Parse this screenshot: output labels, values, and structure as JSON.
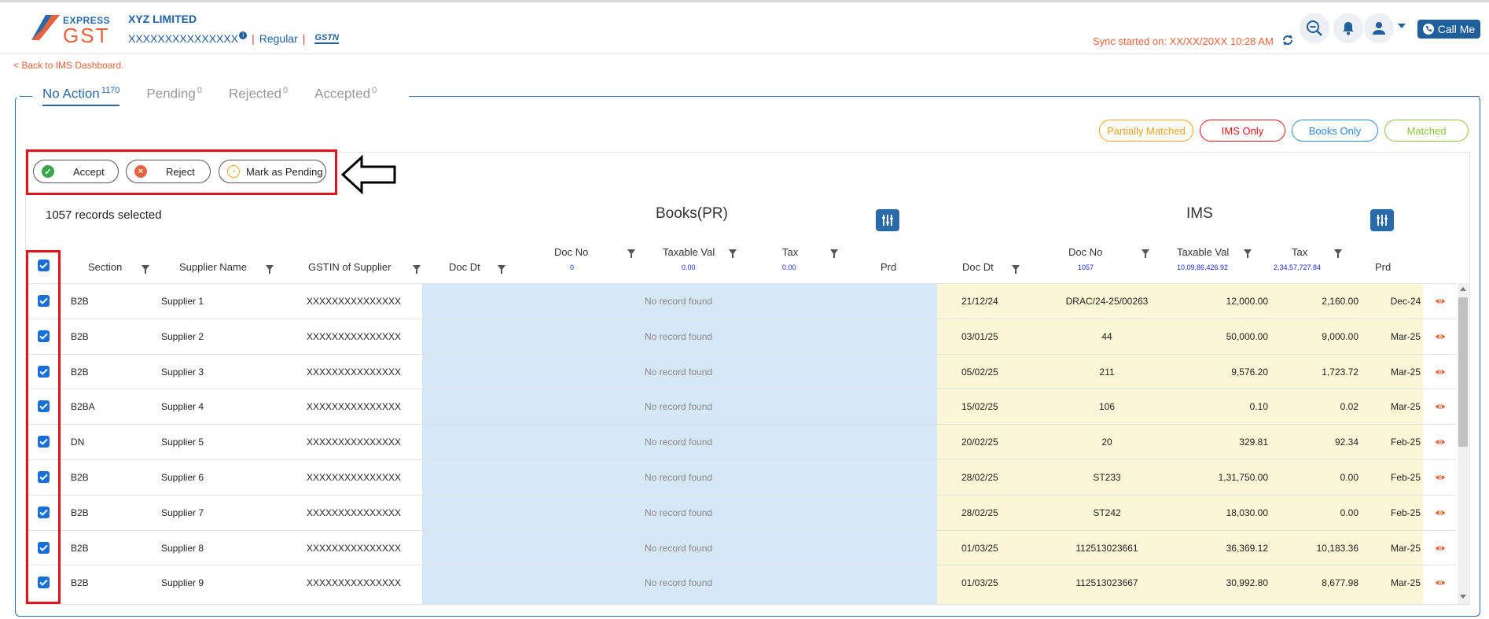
{
  "header": {
    "logo_express": "EXPRESS",
    "logo_gst": "GST",
    "company": "XYZ LIMITED",
    "gstin": "XXXXXXXXXXXXXXX",
    "info_glyph": "i",
    "taxpayer_type": "Regular",
    "gstn_badge": "GSTN",
    "separator": "|",
    "sync_text": "Sync started on: XX/XX/20XX 10:28 AM",
    "call_me": "Call Me"
  },
  "back_link": "< Back to IMS Dashboard.",
  "tabs": [
    {
      "label": "No Action",
      "count": "1170",
      "active": true
    },
    {
      "label": "Pending",
      "count": "0",
      "active": false
    },
    {
      "label": "Rejected",
      "count": "0",
      "active": false
    },
    {
      "label": "Accepted",
      "count": "0",
      "active": false
    }
  ],
  "legend": [
    {
      "label": "Partially Matched",
      "color": "#f0a020"
    },
    {
      "label": "IMS Only",
      "color": "#e0141e"
    },
    {
      "label": "Books Only",
      "color": "#2a8ad6"
    },
    {
      "label": "Matched",
      "color": "#8cc63f"
    }
  ],
  "actions": {
    "accept": "Accept",
    "reject": "Reject",
    "pending": "Mark as Pending"
  },
  "records_selected": "1057 records selected",
  "groups": {
    "books": "Books(PR)",
    "ims": "IMS"
  },
  "columns": {
    "section": "Section",
    "supplier": "Supplier Name",
    "gstin": "GSTIN of Supplier",
    "books_doc_dt": "Doc Dt",
    "books_doc_no": "Doc No",
    "books_doc_no_total": "0",
    "books_taxable": "Taxable Val",
    "books_taxable_total": "0.00",
    "books_tax": "Tax",
    "books_tax_total": "0.00",
    "books_prd": "Prd",
    "ims_doc_dt": "Doc Dt",
    "ims_doc_no": "Doc No",
    "ims_doc_no_total": "1057",
    "ims_taxable": "Taxable Val",
    "ims_taxable_total": "10,09,86,426.92",
    "ims_tax": "Tax",
    "ims_tax_total": "2,34,57,727.84",
    "ims_prd": "Prd"
  },
  "no_record_text": "No record found",
  "rows": [
    {
      "section": "B2B",
      "supplier": "Supplier 1",
      "gstin": "XXXXXXXXXXXXXXX",
      "doc_dt": "21/12/24",
      "doc_no": "DRAC/24-25/00263",
      "taxable": "12,000.00",
      "tax": "2,160.00",
      "prd": "Dec-24"
    },
    {
      "section": "B2B",
      "supplier": "Supplier 2",
      "gstin": "XXXXXXXXXXXXXXX",
      "doc_dt": "03/01/25",
      "doc_no": "44",
      "taxable": "50,000.00",
      "tax": "9,000.00",
      "prd": "Mar-25"
    },
    {
      "section": "B2B",
      "supplier": "Supplier 3",
      "gstin": "XXXXXXXXXXXXXXX",
      "doc_dt": "05/02/25",
      "doc_no": "211",
      "taxable": "9,576.20",
      "tax": "1,723.72",
      "prd": "Mar-25"
    },
    {
      "section": "B2BA",
      "supplier": "Supplier 4",
      "gstin": "XXXXXXXXXXXXXXX",
      "doc_dt": "15/02/25",
      "doc_no": "106",
      "taxable": "0.10",
      "tax": "0.02",
      "prd": "Mar-25"
    },
    {
      "section": "DN",
      "supplier": "Supplier 5",
      "gstin": "XXXXXXXXXXXXXXX",
      "doc_dt": "20/02/25",
      "doc_no": "20",
      "taxable": "329.81",
      "tax": "92.34",
      "prd": "Feb-25"
    },
    {
      "section": "B2B",
      "supplier": "Supplier 6",
      "gstin": "XXXXXXXXXXXXXXX",
      "doc_dt": "28/02/25",
      "doc_no": "ST233",
      "taxable": "1,31,750.00",
      "tax": "0.00",
      "prd": "Feb-25"
    },
    {
      "section": "B2B",
      "supplier": "Supplier 7",
      "gstin": "XXXXXXXXXXXXXXX",
      "doc_dt": "28/02/25",
      "doc_no": "ST242",
      "taxable": "18,030.00",
      "tax": "0.00",
      "prd": "Feb-25"
    },
    {
      "section": "B2B",
      "supplier": "Supplier 8",
      "gstin": "XXXXXXXXXXXXXXX",
      "doc_dt": "01/03/25",
      "doc_no": "112513023661",
      "taxable": "36,369.12",
      "tax": "10,183.36",
      "prd": "Mar-25"
    },
    {
      "section": "B2B",
      "supplier": "Supplier 9",
      "gstin": "XXXXXXXXXXXXXXX",
      "doc_dt": "01/03/25",
      "doc_no": "112513023667",
      "taxable": "30,992.80",
      "tax": "8,677.98",
      "prd": "Mar-25"
    }
  ],
  "colors": {
    "brand_blue": "#2a6aa8",
    "brand_orange": "#e8633c",
    "highlight_red": "#e0141e",
    "books_bg": "#d6e8f8",
    "ims_bg": "#fbf6d6"
  },
  "icons": [
    "logo-icon",
    "info-icon",
    "sync-icon",
    "search-icon",
    "bell-icon",
    "user-icon",
    "phone-icon",
    "check-icon",
    "close-icon",
    "clock-icon",
    "left-arrow-icon",
    "sliders-icon",
    "filter-icon",
    "eye-icon"
  ]
}
